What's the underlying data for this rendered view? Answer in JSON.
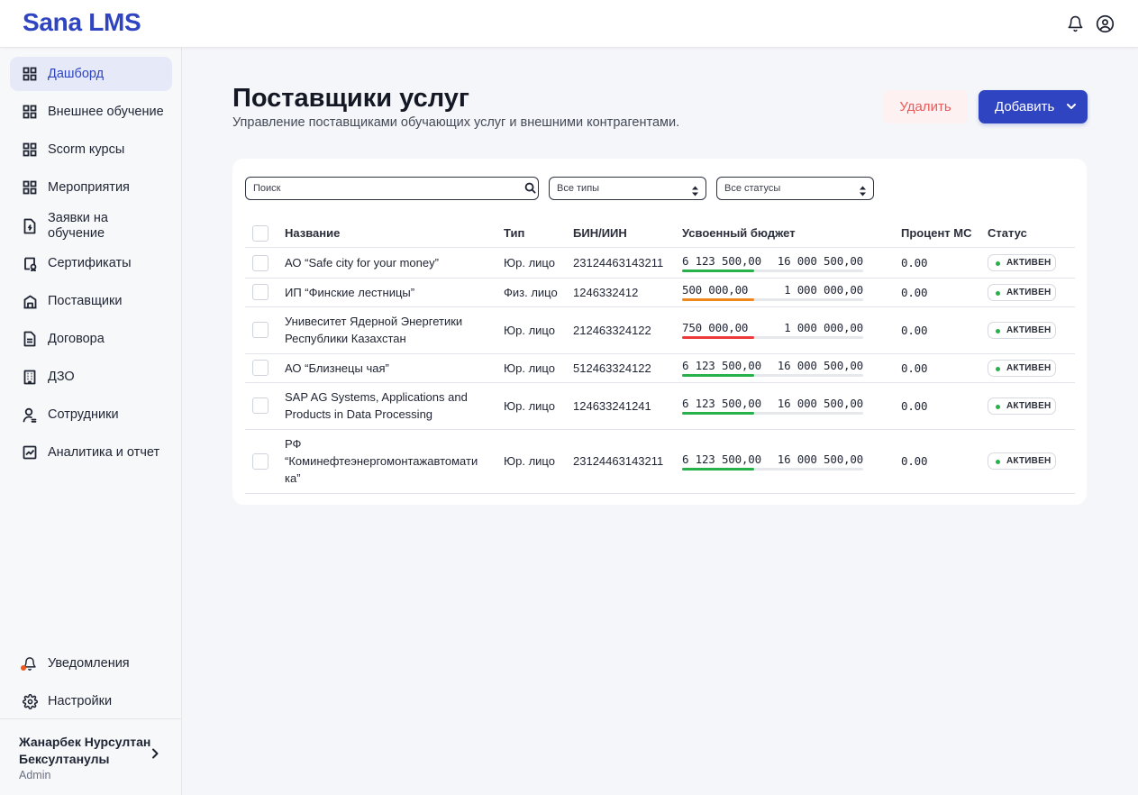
{
  "app": {
    "title": "Sana LMS"
  },
  "topbar": {
    "icons": [
      "bell-icon",
      "user-circle-icon"
    ]
  },
  "sidebar": {
    "items": [
      {
        "label": "Дашборд",
        "icon": "grid-icon",
        "active": true
      },
      {
        "label": "Внешнее обучение",
        "icon": "grid-icon"
      },
      {
        "label": "Scorm курсы",
        "icon": "grid-icon"
      },
      {
        "label": "Мероприятия",
        "icon": "grid-icon"
      },
      {
        "label": "Заявки на обучение",
        "icon": "file-icon"
      },
      {
        "label": "Сертификаты",
        "icon": "certificate-icon"
      },
      {
        "label": "Поставщики",
        "icon": "building-icon"
      },
      {
        "label": "Договора",
        "icon": "document-icon"
      },
      {
        "label": "ДЗО",
        "icon": "office-icon"
      },
      {
        "label": "Сотрудники",
        "icon": "person-icon"
      },
      {
        "label": "Аналитика и отчет",
        "icon": "chart-icon"
      }
    ],
    "bottom_items": [
      {
        "label": "Уведомления",
        "icon": "bell-icon",
        "has_dot": true
      },
      {
        "label": "Настройки",
        "icon": "gear-icon"
      }
    ],
    "user": {
      "name": "Жанарбек Нурсултан Бексултанулы",
      "role": "Admin"
    }
  },
  "header": {
    "title": "Поставщики услуг",
    "subtitle": "Управление поставщиками обучающих услуг и внешними контрагентами.",
    "delete_label": "Удалить",
    "add_label": "Добавить"
  },
  "filters": {
    "search_placeholder": "Поиск",
    "type_select": "Все типы",
    "status_select": "Все статусы"
  },
  "table": {
    "columns": [
      "Название",
      "Тип",
      "БИН/ИИН",
      "Усвоенный бюджет",
      "Процент МС",
      "Статус"
    ],
    "rows": [
      {
        "name": "АО “Safe city for your money”",
        "type": "Юр. лицо",
        "bin": "23124463143211",
        "spent": "6 123 500,00",
        "total": "16 000 500,00",
        "fill": 0.4,
        "color": "#27b14b",
        "percent": "0.00",
        "status": "АКТИВЕН"
      },
      {
        "name": "ИП “Финские лестницы”",
        "type": "Физ. лицо",
        "bin": "1246332412",
        "spent": "500 000,00",
        "total": "1 000 000,00",
        "fill": 0.4,
        "color": "#f0871c",
        "percent": "0.00",
        "status": "АКТИВЕН"
      },
      {
        "name": "Унивеситет Ядерной Энергетики Республики Казахстан",
        "type": "Юр. лицо",
        "bin": "212463324122",
        "spent": "750 000,00",
        "total": "1 000 000,00",
        "fill": 0.4,
        "color": "#ee3a3a",
        "percent": "0.00",
        "status": "АКТИВЕН"
      },
      {
        "name": "АО “Близнецы чая”",
        "type": "Юр. лицо",
        "bin": "512463324122",
        "spent": "6 123 500,00",
        "total": "16 000 500,00",
        "fill": 0.4,
        "color": "#27b14b",
        "percent": "0.00",
        "status": "АКТИВЕН"
      },
      {
        "name": "SAP AG Systems, Applications and Products in Data Processing",
        "type": "Юр. лицо",
        "bin": "124633241241",
        "spent": "6 123 500,00",
        "total": "16 000 500,00",
        "fill": 0.4,
        "color": "#27b14b",
        "percent": "0.00",
        "status": "АКТИВЕН"
      },
      {
        "name": "РФ “Коминефтеэнергомонтажавтомати ка”",
        "type": "Юр. лицо",
        "bin": "23124463143211",
        "spent": "6 123 500,00",
        "total": "16 000 500,00",
        "fill": 0.4,
        "color": "#27b14b",
        "percent": "0.00",
        "status": "АКТИВЕН"
      }
    ]
  },
  "colors": {
    "accent": "#2f44c0",
    "danger": "#ea5a5a",
    "success": "#27b14b",
    "warning": "#f0871c",
    "error": "#ee3a3a"
  }
}
